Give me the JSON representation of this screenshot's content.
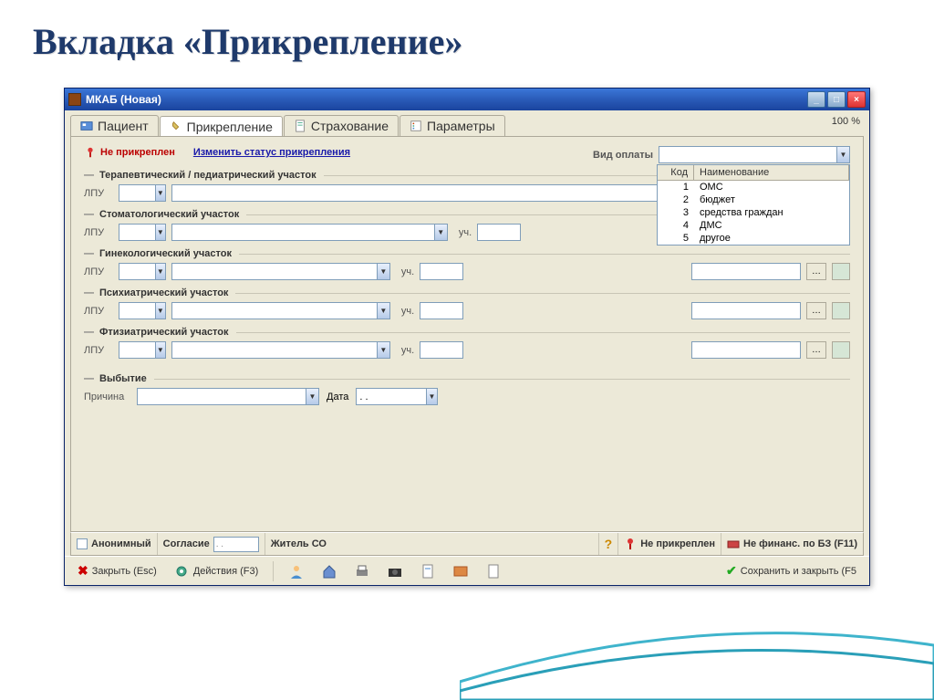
{
  "slide_title": "Вкладка «Прикрепление»",
  "window": {
    "title": "МКАБ (Новая)",
    "percent": "100 %"
  },
  "tabs": [
    {
      "label": "Пациент"
    },
    {
      "label": "Прикрепление"
    },
    {
      "label": "Страхование"
    },
    {
      "label": "Параметры"
    }
  ],
  "status": {
    "not_attached": "Не прикреплен",
    "change_link": "Изменить статус прикрепления",
    "payment_label": "Вид оплаты"
  },
  "dropdown": {
    "header_code": "Код",
    "header_name": "Наименование",
    "rows": [
      {
        "code": "1",
        "name": "ОМС"
      },
      {
        "code": "2",
        "name": "бюджет"
      },
      {
        "code": "3",
        "name": "средства граждан"
      },
      {
        "code": "4",
        "name": "ДМС"
      },
      {
        "code": "5",
        "name": "другое"
      }
    ]
  },
  "sections": {
    "therapeutic": "Терапевтический / педиатрический участок",
    "dental": "Стоматологический участок",
    "gyneco": "Гинекологический участок",
    "psych": "Психиатрический участок",
    "ftiz": "Фтизиатрический участок",
    "leave": "Выбытие",
    "lpu": "ЛПУ",
    "uch": "уч.",
    "reason": "Причина",
    "date": "Дата",
    "date_value": ". ."
  },
  "bottom": {
    "anonymous": "Анонимный",
    "consent": "Согласие",
    "consent_date": ". .",
    "resident": "Житель СО",
    "question": "?",
    "not_attached": "Не прикреплен",
    "no_finance": "Не финанс. по БЗ (F11)"
  },
  "toolbar": {
    "close": "Закрыть (Esc)",
    "actions": "Действия (F3)",
    "save": "Сохранить и закрыть (F5"
  }
}
